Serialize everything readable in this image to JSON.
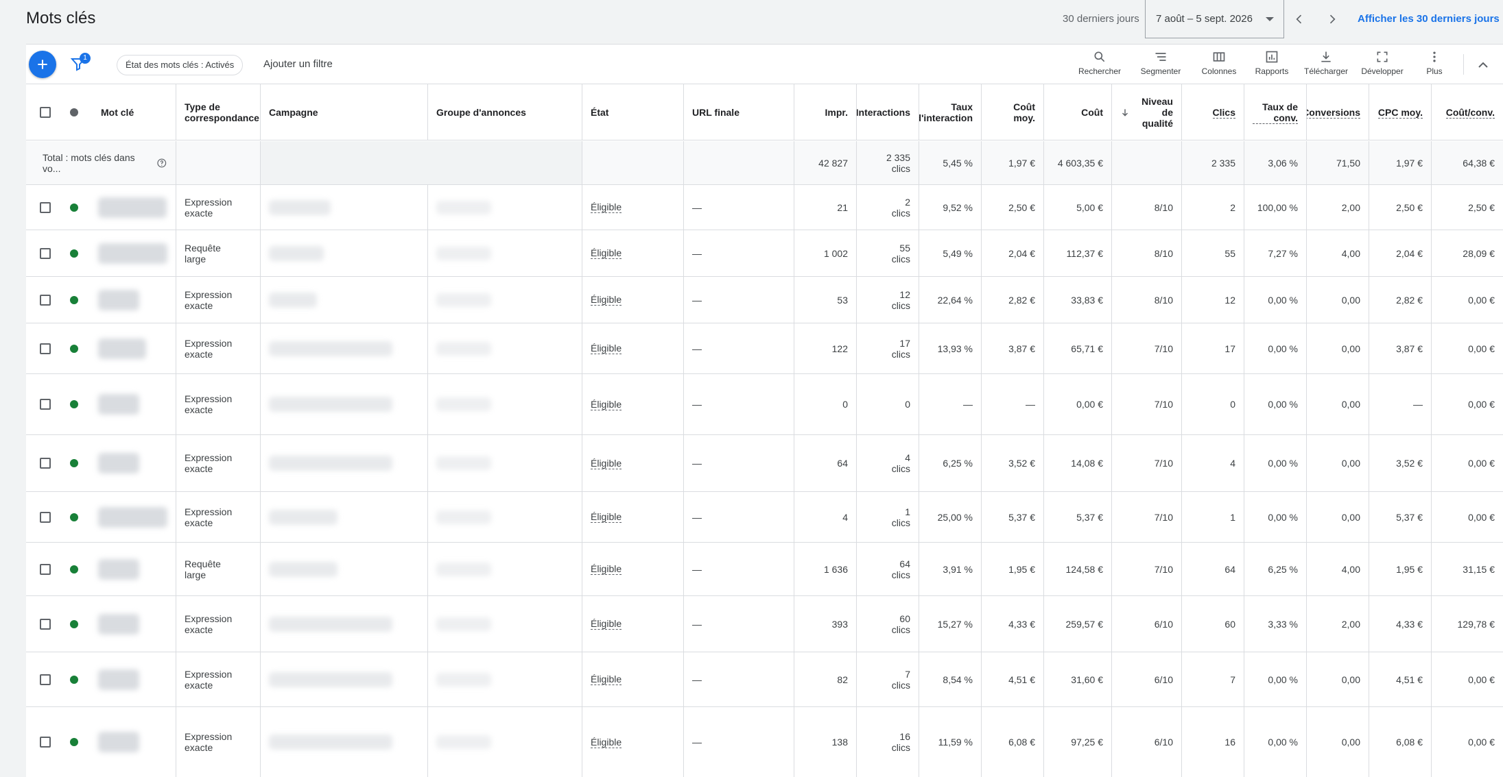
{
  "header": {
    "title": "Mots clés",
    "range_label": "30 derniers jours",
    "date_range": "7 août – 5 sept. 2026",
    "show_link": "Afficher les 30 derniers jours"
  },
  "toolbar": {
    "filter_count": "1",
    "filter_chip": "État des mots clés : Activés",
    "add_filter": "Ajouter un filtre",
    "tools": [
      {
        "label": "Rechercher",
        "icon": "search-icon"
      },
      {
        "label": "Segmenter",
        "icon": "segment-icon"
      },
      {
        "label": "Colonnes",
        "icon": "columns-icon"
      },
      {
        "label": "Rapports",
        "icon": "reports-icon"
      },
      {
        "label": "Télécharger",
        "icon": "download-icon"
      },
      {
        "label": "Développer",
        "icon": "expand-icon"
      },
      {
        "label": "Plus",
        "icon": "more-vert-icon"
      }
    ]
  },
  "table": {
    "headers": {
      "keyword": "Mot clé",
      "match_type": "Type de correspondance",
      "campaign": "Campagne",
      "ad_group": "Groupe d'annonces",
      "status": "État",
      "final_url": "URL finale",
      "impr": "Impr.",
      "interactions": "Interactions",
      "interaction_rate": "Taux d'interaction",
      "avg_cost": "Coût moy.",
      "cost": "Coût",
      "quality": "Niveau de qualité",
      "clicks": "Clics",
      "conv_rate": "Taux de conv.",
      "conversions": "Conversions",
      "avg_cpc": "CPC moy.",
      "cost_conv": "Coût/conv."
    },
    "total": {
      "label": "Total : mots clés dans vo...",
      "impr": "42 827",
      "interactions": "2 335",
      "interactions_unit": "clics",
      "interaction_rate": "5,45 %",
      "avg_cost": "1,97 €",
      "cost": "4 603,35 €",
      "clicks": "2 335",
      "conv_rate": "3,06 %",
      "conversions": "71,50",
      "avg_cpc": "1,97 €",
      "cost_conv": "64,38 €"
    },
    "colors": {
      "active_dot": "#188038",
      "accent": "#1a73e8"
    },
    "rows": [
      {
        "match1": "Expression",
        "match2": "exacte",
        "status": "Éligible",
        "url": "—",
        "impr": "21",
        "int_n": "2",
        "int_u": "clics",
        "int_rate": "9,52 %",
        "avg_cost": "2,50 €",
        "cost": "5,00 €",
        "quality": "8/10",
        "clicks": "2",
        "conv_rate": "100,00 %",
        "conversions": "2,00",
        "avg_cpc": "2,50 €",
        "cost_conv": "2,50 €"
      },
      {
        "match1": "Requête",
        "match2": "large",
        "status": "Éligible",
        "url": "—",
        "impr": "1 002",
        "int_n": "55",
        "int_u": "clics",
        "int_rate": "5,49 %",
        "avg_cost": "2,04 €",
        "cost": "112,37 €",
        "quality": "8/10",
        "clicks": "55",
        "conv_rate": "7,27 %",
        "conversions": "4,00",
        "avg_cpc": "2,04 €",
        "cost_conv": "28,09 €"
      },
      {
        "match1": "Expression",
        "match2": "exacte",
        "status": "Éligible",
        "url": "—",
        "impr": "53",
        "int_n": "12",
        "int_u": "clics",
        "int_rate": "22,64 %",
        "avg_cost": "2,82 €",
        "cost": "33,83 €",
        "quality": "8/10",
        "clicks": "12",
        "conv_rate": "0,00 %",
        "conversions": "0,00",
        "avg_cpc": "2,82 €",
        "cost_conv": "0,00 €"
      },
      {
        "match1": "Expression",
        "match2": "exacte",
        "status": "Éligible",
        "url": "—",
        "impr": "122",
        "int_n": "17",
        "int_u": "clics",
        "int_rate": "13,93 %",
        "avg_cost": "3,87 €",
        "cost": "65,71 €",
        "quality": "7/10",
        "clicks": "17",
        "conv_rate": "0,00 %",
        "conversions": "0,00",
        "avg_cpc": "3,87 €",
        "cost_conv": "0,00 €"
      },
      {
        "match1": "Expression",
        "match2": "exacte",
        "status": "Éligible",
        "url": "—",
        "impr": "0",
        "int_n": "0",
        "int_u": "",
        "int_rate": "—",
        "avg_cost": "—",
        "cost": "0,00 €",
        "quality": "7/10",
        "clicks": "0",
        "conv_rate": "0,00 %",
        "conversions": "0,00",
        "avg_cpc": "—",
        "cost_conv": "0,00 €"
      },
      {
        "match1": "Expression",
        "match2": "exacte",
        "status": "Éligible",
        "url": "—",
        "impr": "64",
        "int_n": "4",
        "int_u": "clics",
        "int_rate": "6,25 %",
        "avg_cost": "3,52 €",
        "cost": "14,08 €",
        "quality": "7/10",
        "clicks": "4",
        "conv_rate": "0,00 %",
        "conversions": "0,00",
        "avg_cpc": "3,52 €",
        "cost_conv": "0,00 €"
      },
      {
        "match1": "Expression",
        "match2": "exacte",
        "status": "Éligible",
        "url": "—",
        "impr": "4",
        "int_n": "1",
        "int_u": "clics",
        "int_rate": "25,00 %",
        "avg_cost": "5,37 €",
        "cost": "5,37 €",
        "quality": "7/10",
        "clicks": "1",
        "conv_rate": "0,00 %",
        "conversions": "0,00",
        "avg_cpc": "5,37 €",
        "cost_conv": "0,00 €"
      },
      {
        "match1": "Requête",
        "match2": "large",
        "status": "Éligible",
        "url": "—",
        "impr": "1 636",
        "int_n": "64",
        "int_u": "clics",
        "int_rate": "3,91 %",
        "avg_cost": "1,95 €",
        "cost": "124,58 €",
        "quality": "7/10",
        "clicks": "64",
        "conv_rate": "6,25 %",
        "conversions": "4,00",
        "avg_cpc": "1,95 €",
        "cost_conv": "31,15 €"
      },
      {
        "match1": "Expression",
        "match2": "exacte",
        "status": "Éligible",
        "url": "—",
        "impr": "393",
        "int_n": "60",
        "int_u": "clics",
        "int_rate": "15,27 %",
        "avg_cost": "4,33 €",
        "cost": "259,57 €",
        "quality": "6/10",
        "clicks": "60",
        "conv_rate": "3,33 %",
        "conversions": "2,00",
        "avg_cpc": "4,33 €",
        "cost_conv": "129,78 €"
      },
      {
        "match1": "Expression",
        "match2": "exacte",
        "status": "Éligible",
        "url": "—",
        "impr": "82",
        "int_n": "7",
        "int_u": "clics",
        "int_rate": "8,54 %",
        "avg_cost": "4,51 €",
        "cost": "31,60 €",
        "quality": "6/10",
        "clicks": "7",
        "conv_rate": "0,00 %",
        "conversions": "0,00",
        "avg_cpc": "4,51 €",
        "cost_conv": "0,00 €"
      },
      {
        "match1": "Expression",
        "match2": "exacte",
        "status": "Éligible",
        "url": "—",
        "impr": "138",
        "int_n": "16",
        "int_u": "clics",
        "int_rate": "11,59 %",
        "avg_cost": "6,08 €",
        "cost": "97,25 €",
        "quality": "6/10",
        "clicks": "16",
        "conv_rate": "0,00 %",
        "conversions": "0,00",
        "avg_cpc": "6,08 €",
        "cost_conv": "0,00 €"
      }
    ]
  }
}
